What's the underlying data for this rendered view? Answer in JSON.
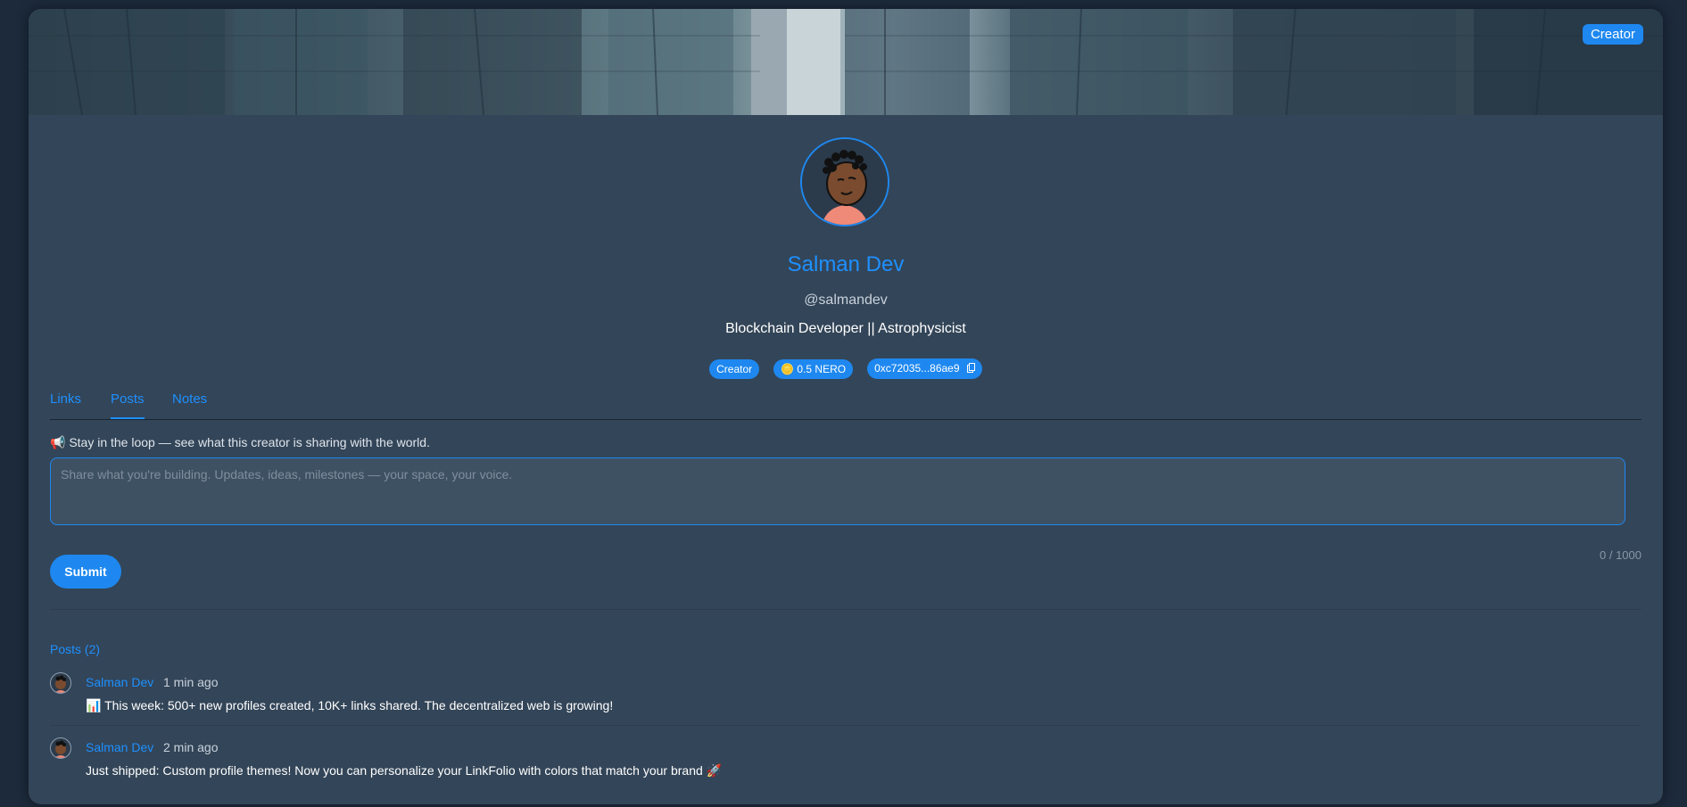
{
  "corner_badge": "Creator",
  "profile": {
    "name": "Salman Dev",
    "handle": "@salmandev",
    "bio": "Blockchain Developer || Astrophysicist",
    "badges": {
      "role": "Creator",
      "balance": "🪙 0.5 NERO",
      "wallet": "0xc72035...86ae9"
    }
  },
  "tabs": [
    {
      "label": "Links"
    },
    {
      "label": "Posts"
    },
    {
      "label": "Notes"
    }
  ],
  "active_tab": "Posts",
  "posts_section": {
    "intro": "📢 Stay in the loop — see what this creator is sharing with the world.",
    "placeholder": "Share what you're building. Updates, ideas, milestones — your space, your voice.",
    "value": "",
    "counter": "0 / 1000",
    "submit_label": "Submit",
    "list_title": "Posts (2)",
    "posts": [
      {
        "author": "Salman Dev",
        "time": "1 min ago",
        "text": "📊 This week: 500+ new profiles created, 10K+ links shared. The decentralized web is growing!"
      },
      {
        "author": "Salman Dev",
        "time": "2 min ago",
        "text": "Just shipped: Custom profile themes! Now you can personalize your LinkFolio with colors that match your brand 🚀"
      }
    ]
  },
  "colors": {
    "accent": "#1e88f0",
    "card_bg": "#334558",
    "page_bg": "#1c2a3b"
  },
  "icons": {
    "copy": "copy-icon",
    "coin": "coin-icon"
  }
}
